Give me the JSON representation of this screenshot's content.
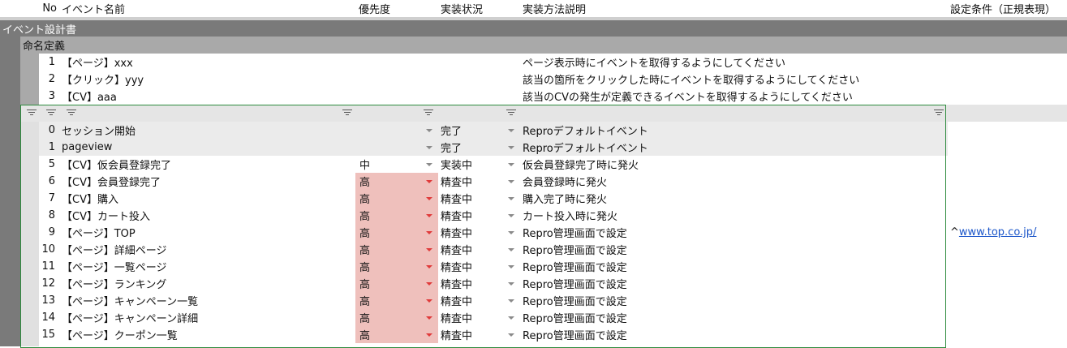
{
  "header": {
    "no": "No",
    "event_name": "イベント名前",
    "priority": "優先度",
    "status": "実装状況",
    "method": "実装方法説明",
    "condition": "設定条件（正規表現）"
  },
  "group1": "イベント設計書",
  "group2": "命名定義",
  "naming": [
    {
      "no": "1",
      "name": "【ページ】xxx",
      "desc": "ページ表示時にイベントを取得するようにしてください"
    },
    {
      "no": "2",
      "name": "【クリック】yyy",
      "desc": "該当の箇所をクリックした時にイベントを取得するようにしてください"
    },
    {
      "no": "3",
      "name": "【CV】aaa",
      "desc": "該当のCVの発生が定義できるイベントを取得するようにしてください"
    }
  ],
  "events": [
    {
      "no": "0",
      "name": "セッション開始",
      "priority": "",
      "status": "完了",
      "method": "Reproデフォルトイベント",
      "condition": ""
    },
    {
      "no": "1",
      "name": "pageview",
      "priority": "",
      "status": "完了",
      "method": "Reproデフォルトイベント",
      "condition": ""
    },
    {
      "no": "5",
      "name": "【CV】仮会員登録完了",
      "priority": "中",
      "status": "実装中",
      "method": "仮会員登録完了時に発火",
      "condition": ""
    },
    {
      "no": "6",
      "name": "【CV】会員登録完了",
      "priority": "高",
      "status": "精査中",
      "method": "会員登録時に発火",
      "condition": ""
    },
    {
      "no": "7",
      "name": "【CV】購入",
      "priority": "高",
      "status": "精査中",
      "method": "購入完了時に発火",
      "condition": ""
    },
    {
      "no": "8",
      "name": "【CV】カート投入",
      "priority": "高",
      "status": "精査中",
      "method": "カート投入時に発火",
      "condition": ""
    },
    {
      "no": "9",
      "name": "【ページ】TOP",
      "priority": "高",
      "status": "精査中",
      "method": "Repro管理画面で設定",
      "condition_prefix": "^",
      "condition": "www.top.co.jp/"
    },
    {
      "no": "10",
      "name": "【ページ】詳細ページ",
      "priority": "高",
      "status": "精査中",
      "method": "Repro管理画面で設定",
      "condition": ""
    },
    {
      "no": "11",
      "name": "【ページ】一覧ページ",
      "priority": "高",
      "status": "精査中",
      "method": "Repro管理画面で設定",
      "condition": ""
    },
    {
      "no": "12",
      "name": "【ページ】ランキング",
      "priority": "高",
      "status": "精査中",
      "method": "Repro管理画面で設定",
      "condition": ""
    },
    {
      "no": "13",
      "name": "【ページ】キャンペーン一覧",
      "priority": "高",
      "status": "精査中",
      "method": "Repro管理画面で設定",
      "condition": ""
    },
    {
      "no": "14",
      "name": "【ページ】キャンペーン詳細",
      "priority": "高",
      "status": "精査中",
      "method": "Repro管理画面で設定",
      "condition": ""
    },
    {
      "no": "15",
      "name": "【ページ】クーポン一覧",
      "priority": "高",
      "status": "精査中",
      "method": "Repro管理画面で設定",
      "condition": ""
    }
  ],
  "colors": {
    "priority_high_bg": "#efc0bc",
    "group_dark": "#7a7a7a",
    "group_light": "#a9a9a9",
    "filter_border": "#2e8b3e",
    "link": "#1a55c9",
    "dropdown_red": "#e03a3a"
  },
  "icons": {
    "filter": "filter-icon",
    "dropdown": "chevron-down-icon"
  }
}
